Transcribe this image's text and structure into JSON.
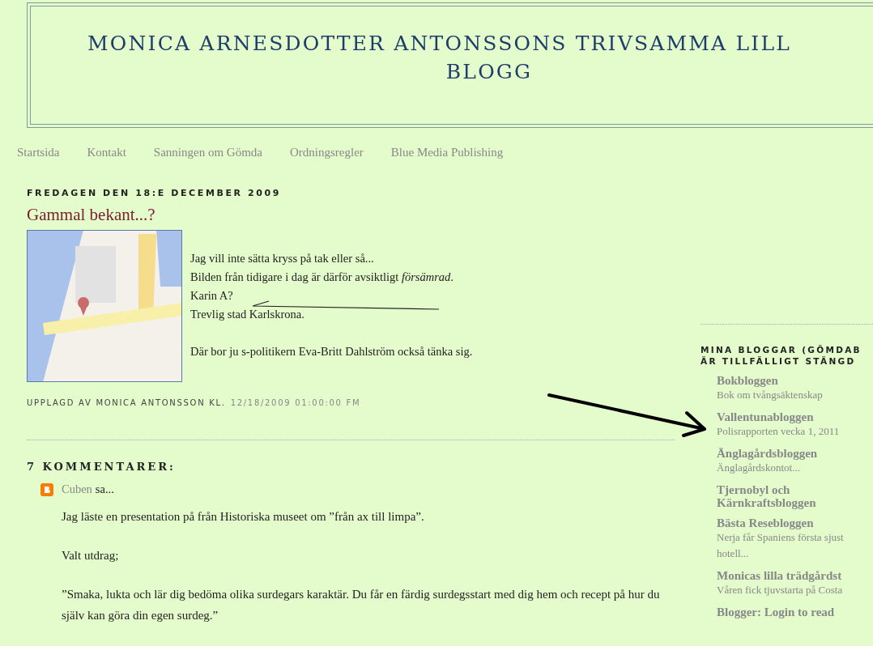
{
  "header": {
    "title_lines": [
      "MONICA ARNESDOTTER ANTONSSONS TRIVSAMMA LILL",
      "BLOGG"
    ]
  },
  "nav": [
    "Startsida",
    "Kontakt",
    "Sanningen om Gömda",
    "Ordningsregler",
    "Blue Media Publishing"
  ],
  "post": {
    "date": "FREDAGEN DEN 18:E DECEMBER 2009",
    "title": "Gammal bekant...?",
    "paragraphs": [
      [
        "Jag vill inte sätta kryss på tak eller så...",
        "Bilden från tidigare i dag är därför avsiktligt *försämrad*.",
        "Karin A?",
        "Trevlig stad Karlskrona."
      ],
      [
        "Där bor ju s-politikern Eva-Britt Dahlström också tänka sig."
      ]
    ],
    "footer_label": "UPPLAGD AV MONICA ANTONSSON KL.",
    "timestamp": "12/18/2009 01:00:00 FM"
  },
  "comments": {
    "heading": "7 KOMMENTARER:",
    "items": [
      {
        "author": "Cuben",
        "says": "sa...",
        "paragraphs": [
          "Jag läste en presentation på från Historiska museet om ”från ax till limpa”.",
          "Valt utdrag;",
          "”Smaka, lukta och lär dig bedöma olika surdegars karaktär. Du får en färdig surdegsstart med dig hem och recept på hur du själv kan göra din egen surdeg.”"
        ]
      }
    ]
  },
  "sidebar": {
    "heading_lines": [
      "MINA BLOGGAR (GÖMDAB",
      "ÄR TILLFÄLLIGT STÄNGD"
    ],
    "blogs": [
      {
        "name": "Bokbloggen",
        "latest": "Bok om tvångsäktenskap"
      },
      {
        "name": "Vallentunabloggen",
        "latest": "Polisrapporten vecka 1, 2011"
      },
      {
        "name": "Änglagårdsbloggen",
        "latest": "Änglagårdskontot..."
      },
      {
        "name": "Tjernobyl och Kärnkraftsbloggen"
      },
      {
        "name": "Bästa Resebloggen",
        "latest": "Nerja får Spaniens första sjust hotell..."
      },
      {
        "name": "Monicas lilla trädgårdst",
        "latest": "Våren fick tjuvstarta på Costa"
      },
      {
        "name": "Blogger: Login to read"
      }
    ]
  }
}
